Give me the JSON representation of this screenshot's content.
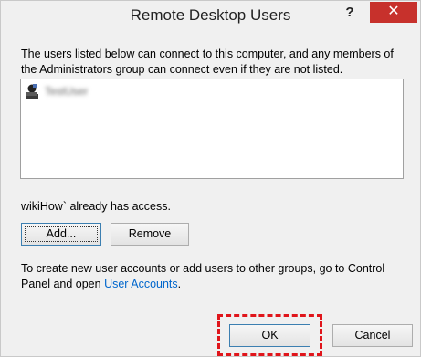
{
  "window": {
    "title": "Remote Desktop Users",
    "help_label": "?",
    "close_label": "✕"
  },
  "description": "The users listed below can connect to this computer, and any members of the Administrators group can connect even if they are not listed.",
  "users_list": {
    "items": [
      {
        "name": "TestUser",
        "icon": "user-icon"
      }
    ]
  },
  "access_text": "wikiHow` already has access.",
  "buttons": {
    "add": "Add...",
    "remove": "Remove",
    "ok": "OK",
    "cancel": "Cancel"
  },
  "info": {
    "text_before_link": "To create new user accounts or add users to other groups, go to Control Panel and open ",
    "link_text": "User Accounts",
    "text_after_link": "."
  },
  "colors": {
    "close_button": "#c7312c",
    "link": "#0066cc",
    "highlight": "#e0151b"
  }
}
